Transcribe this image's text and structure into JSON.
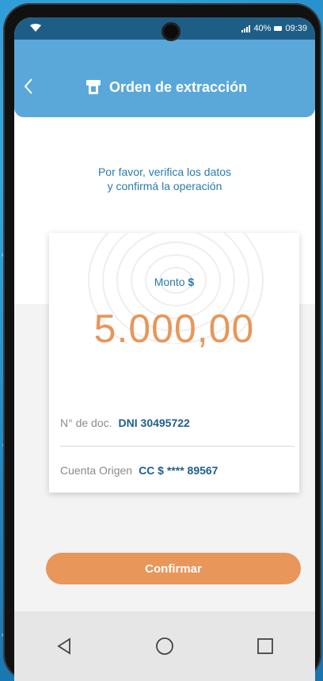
{
  "status_bar": {
    "battery": "40%",
    "time": "09:39"
  },
  "header": {
    "title": "Orden de extracción"
  },
  "instructions": {
    "line1": "Por favor, verifica los datos",
    "line2": "y confirmá la operación"
  },
  "card": {
    "amount_label": "Monto",
    "amount_currency": "$",
    "amount_value": "5.000,00",
    "doc_label": "N° de doc.",
    "doc_value": "DNI 30495722",
    "account_label": "Cuenta Origen",
    "account_value": "CC $ **** 89567"
  },
  "actions": {
    "confirm_label": "Confirmar"
  },
  "colors": {
    "header": "#5aa8da",
    "accent": "#e8965a",
    "text_blue": "#2a7ab0"
  },
  "icons": [
    "wifi-icon",
    "signal-icon",
    "battery-icon",
    "back-chevron-icon",
    "atm-icon",
    "fingerprint-icon",
    "nav-back-icon",
    "nav-home-icon",
    "nav-recents-icon"
  ]
}
